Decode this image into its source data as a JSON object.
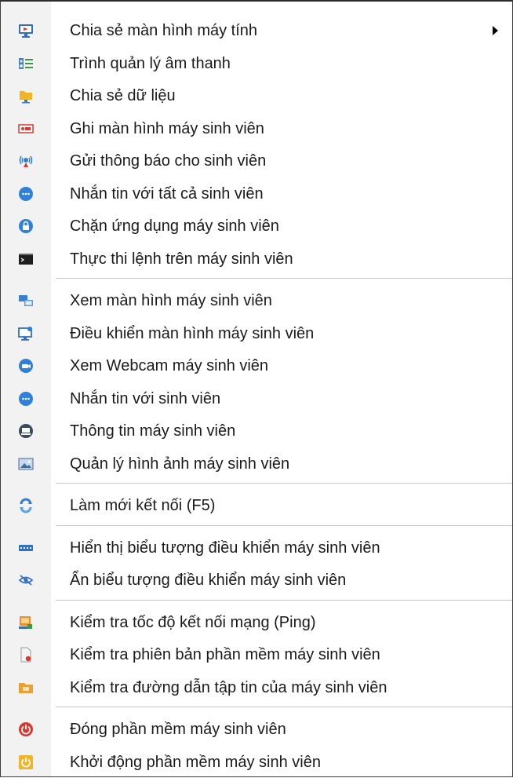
{
  "colors": {
    "text": "#1a1a1a",
    "gutter": "#f2f2f2",
    "separator": "#c8c8c8",
    "accent_blue": "#2f80d8",
    "accent_red": "#d9382f",
    "accent_orange": "#e7912b"
  },
  "menu": {
    "groups": [
      {
        "items": [
          {
            "label": "Chia sẻ màn hình máy tính",
            "icon": "share-screen-icon",
            "submenu": true
          },
          {
            "label": "Trình quản lý âm thanh",
            "icon": "audio-manager-icon"
          },
          {
            "label": "Chia sẻ dữ liệu",
            "icon": "folder-share-icon"
          },
          {
            "label": "Ghi màn hình máy sinh viên",
            "icon": "record-screen-icon"
          },
          {
            "label": "Gửi thông báo cho sinh viên",
            "icon": "broadcast-icon"
          },
          {
            "label": "Nhắn tin với tất cả sinh viên",
            "icon": "chat-icon"
          },
          {
            "label": "Chặn ứng dụng máy sinh viên",
            "icon": "block-app-icon"
          },
          {
            "label": "Thực thi lệnh trên máy sinh viên",
            "icon": "terminal-icon"
          }
        ]
      },
      {
        "items": [
          {
            "label": "Xem màn hình máy sinh viên",
            "icon": "view-screen-icon"
          },
          {
            "label": "Điều khiển màn hình máy sinh viên",
            "icon": "remote-control-icon"
          },
          {
            "label": "Xem Webcam máy sinh viên",
            "icon": "webcam-icon"
          },
          {
            "label": "Nhắn tin với sinh viên",
            "icon": "chat-single-icon"
          },
          {
            "label": "Thông tin máy sinh viên",
            "icon": "computer-info-icon"
          },
          {
            "label": "Quản lý hình ảnh máy sinh viên",
            "icon": "image-manager-icon"
          }
        ]
      },
      {
        "items": [
          {
            "label": "Làm mới kết nối (F5)",
            "icon": "refresh-icon"
          }
        ]
      },
      {
        "items": [
          {
            "label": "Hiển thị biểu tượng điều khiển máy sinh viên",
            "icon": "show-toolbar-icon"
          },
          {
            "label": "Ẩn biểu tượng điều khiển máy sinh viên",
            "icon": "hide-eye-icon"
          }
        ]
      },
      {
        "items": [
          {
            "label": "Kiểm tra tốc độ kết nối mạng (Ping)",
            "icon": "ping-icon"
          },
          {
            "label": "Kiểm tra phiên bản phần mềm máy sinh viên",
            "icon": "version-check-icon"
          },
          {
            "label": "Kiểm tra đường dẫn tập tin của máy sinh viên",
            "icon": "file-path-icon"
          }
        ]
      },
      {
        "items": [
          {
            "label": "Đóng phần mềm máy sinh viên",
            "icon": "power-off-icon"
          },
          {
            "label": "Khởi động phần mềm máy sinh viên",
            "icon": "power-on-icon"
          }
        ]
      }
    ]
  }
}
